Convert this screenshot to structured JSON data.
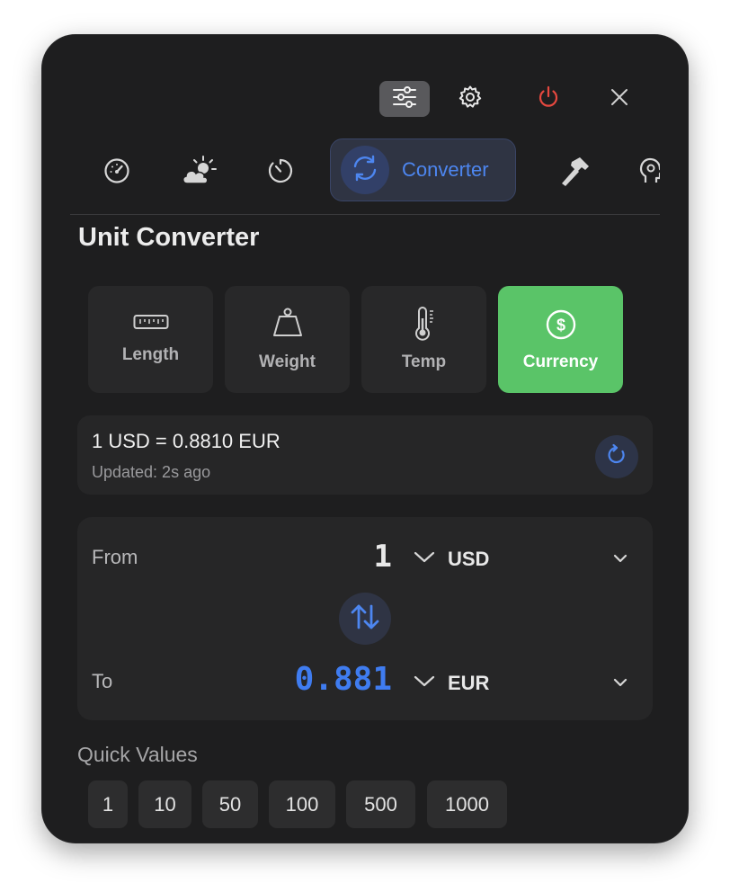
{
  "topbar": {
    "icons": [
      "sliders-icon",
      "gear-icon",
      "power-icon",
      "close-icon"
    ],
    "power_color": "#e5483f"
  },
  "tabs": {
    "items": [
      {
        "icon": "gauge-icon"
      },
      {
        "icon": "cloud-sun-icon"
      },
      {
        "icon": "timer-icon"
      },
      {
        "icon": "convert-arrows-icon",
        "label": "Converter",
        "active": true
      },
      {
        "icon": "hammer-icon"
      },
      {
        "icon": "head-icon"
      }
    ],
    "accent": "#4d86f0"
  },
  "page": {
    "title": "Unit Converter"
  },
  "categories": [
    {
      "label": "Length",
      "icon": "ruler-icon"
    },
    {
      "label": "Weight",
      "icon": "weight-icon"
    },
    {
      "label": "Temp",
      "icon": "thermometer-icon"
    },
    {
      "label": "Currency",
      "icon": "dollar-circle-icon",
      "selected": true,
      "color": "#5ac468"
    }
  ],
  "rate": {
    "text": "1 USD = 0.8810 EUR",
    "updated": "Updated: 2s ago"
  },
  "converter": {
    "from": {
      "label": "From",
      "value": "1",
      "unit": "USD"
    },
    "to": {
      "label": "To",
      "value": "0.881",
      "unit": "EUR",
      "color": "#3f7cf0"
    }
  },
  "quick_values": {
    "title": "Quick Values",
    "items": [
      "1",
      "10",
      "50",
      "100",
      "500",
      "1000"
    ]
  }
}
